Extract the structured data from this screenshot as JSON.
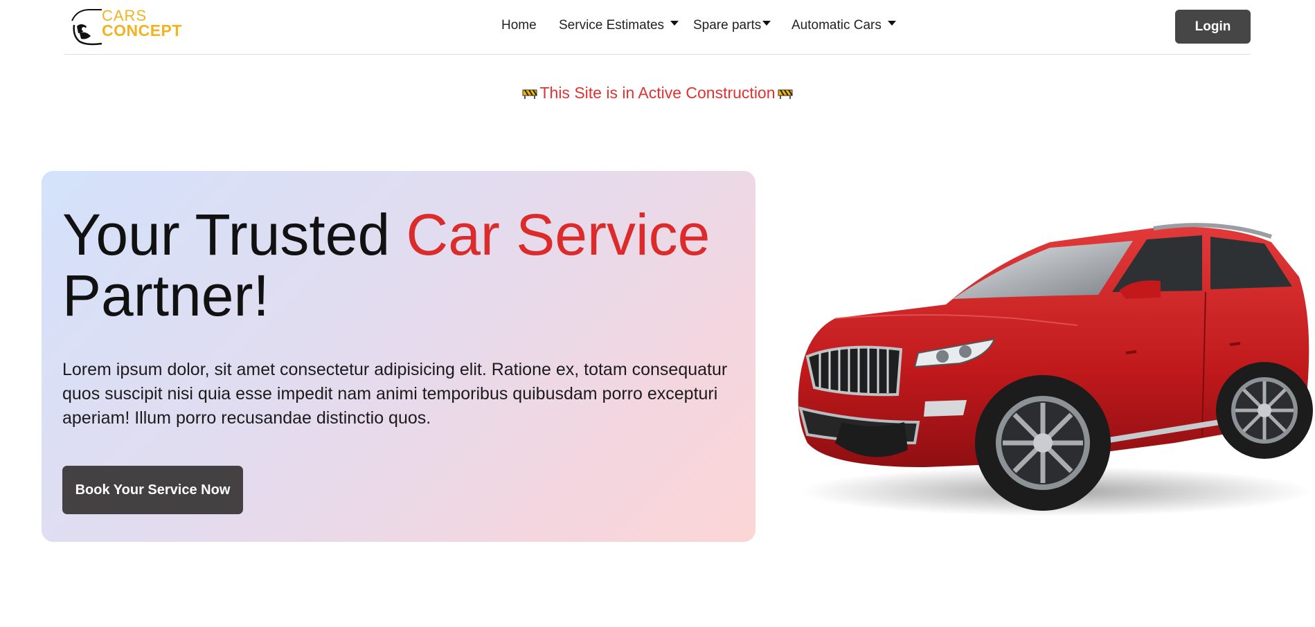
{
  "header": {
    "logo": {
      "top": "CARS",
      "bottom": "CONCEPT"
    },
    "nav": [
      {
        "label": "Home"
      },
      {
        "label": "Service Estimates"
      },
      {
        "label": "Spare parts"
      },
      {
        "label": "Automatic Cars"
      }
    ],
    "login_label": "Login"
  },
  "banner": {
    "text": "This Site is in Active Construction"
  },
  "hero": {
    "title_part1": "Your Trusted ",
    "title_accent": "Car Service",
    "title_part2": "Partner!",
    "description": "Lorem ipsum dolor, sit amet consectetur adipisicing elit. Ratione ex, totam consequatur quos suscipit nisi quia esse impedit nam animi temporibus quibusdam porro excepturi aperiam! Illum porro recusandae distinctio quos.",
    "cta_label": "Book Your Service Now"
  },
  "colors": {
    "accent_red": "#dc2b2b",
    "logo_yellow": "#f2b320",
    "button_dark": "#464646"
  }
}
